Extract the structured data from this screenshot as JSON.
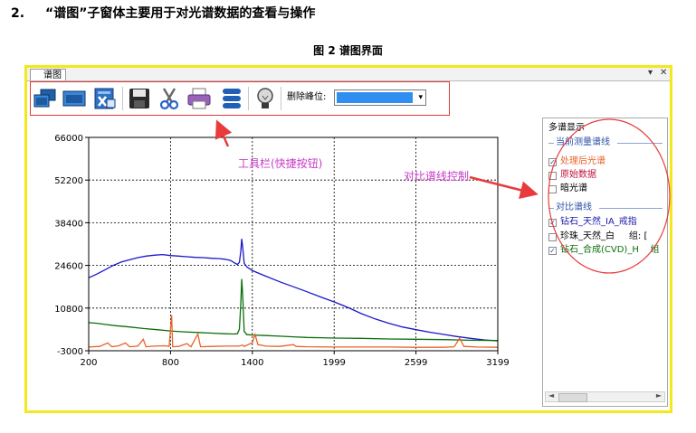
{
  "document": {
    "section_number": "2.",
    "section_heading": "“谱图”子窗体主要用于对光谱数据的查看与操作",
    "figure_caption": "图 2 谱图界面"
  },
  "window": {
    "tab_label": "谱图",
    "pin_glyph": "▾",
    "close_glyph": "✕"
  },
  "toolbar": {
    "buttons": [
      {
        "name": "restore-window-icon"
      },
      {
        "name": "maximize-window-icon"
      },
      {
        "name": "excel-export-icon"
      },
      {
        "name": "save-icon"
      },
      {
        "name": "cut-icon"
      },
      {
        "name": "print-icon"
      },
      {
        "name": "layers-icon"
      },
      {
        "name": "lightbulb-icon"
      }
    ],
    "peak_remove_label": "删除峰位:",
    "peak_remove_color": "#2f8ef0",
    "dropdown_glyph": "▾"
  },
  "panel": {
    "title": "多谱显示",
    "current_group_title": "当前测量谱线",
    "current_items": [
      {
        "label": "处理后光谱",
        "checked": true,
        "color": "#e8632a"
      },
      {
        "label": "原始数据",
        "checked": false,
        "color": "#c0143c"
      },
      {
        "label": "暗光谱",
        "checked": false,
        "color": "#000000"
      }
    ],
    "compare_group_title": "对比谱线",
    "compare_items": [
      {
        "label": "钻石_天然_IA_戒指",
        "checked": true,
        "color": "#1a1aa8"
      },
      {
        "label": "珍珠_天然_白     组: [",
        "checked": false,
        "color": "#000000"
      },
      {
        "label": "钻石_合成(CVD)_H    组",
        "checked": true,
        "color": "#0a6e0a"
      }
    ],
    "check_glyph": "✓",
    "scroll_left": "◄",
    "scroll_right": "►",
    "scroll_thumb": "|||"
  },
  "annotations": {
    "toolbar_note": "工具栏(快捷按钮)",
    "compare_note": "对比谱线控制",
    "arrow_color": "#e83c3c",
    "text_color": "#c83bc8"
  },
  "chart_data": {
    "type": "line",
    "xlim": [
      200,
      3199
    ],
    "ylim": [
      -3000,
      66000
    ],
    "x_ticks": [
      "200",
      "800",
      "1400",
      "1999",
      "2599",
      "3199"
    ],
    "y_ticks": [
      "66000",
      "52200",
      "38400",
      "24600",
      "10800",
      "-3000"
    ],
    "grid": true,
    "series": [
      {
        "color": "#1818c8",
        "points": [
          [
            200,
            20600
          ],
          [
            260,
            21800
          ],
          [
            320,
            23200
          ],
          [
            380,
            24600
          ],
          [
            440,
            25700
          ],
          [
            500,
            26400
          ],
          [
            560,
            27100
          ],
          [
            620,
            27600
          ],
          [
            680,
            27900
          ],
          [
            740,
            28100
          ],
          [
            800,
            27800
          ],
          [
            860,
            27600
          ],
          [
            920,
            27400
          ],
          [
            980,
            27200
          ],
          [
            1040,
            27100
          ],
          [
            1100,
            26900
          ],
          [
            1160,
            26800
          ],
          [
            1200,
            26600
          ],
          [
            1240,
            26200
          ],
          [
            1270,
            25400
          ],
          [
            1290,
            24900
          ],
          [
            1305,
            25600
          ],
          [
            1315,
            29000
          ],
          [
            1322,
            33200
          ],
          [
            1330,
            30000
          ],
          [
            1340,
            25300
          ],
          [
            1360,
            24100
          ],
          [
            1400,
            22900
          ],
          [
            1500,
            21100
          ],
          [
            1600,
            19300
          ],
          [
            1700,
            17700
          ],
          [
            1800,
            16100
          ],
          [
            1900,
            14400
          ],
          [
            2000,
            12800
          ],
          [
            2100,
            11000
          ],
          [
            2200,
            9000
          ],
          [
            2300,
            7300
          ],
          [
            2400,
            5900
          ],
          [
            2500,
            4700
          ],
          [
            2600,
            3800
          ],
          [
            2700,
            3000
          ],
          [
            2800,
            2300
          ],
          [
            2900,
            1600
          ],
          [
            3000,
            1000
          ],
          [
            3100,
            500
          ],
          [
            3199,
            200
          ]
        ]
      },
      {
        "color": "#0a6e0a",
        "points": [
          [
            200,
            6100
          ],
          [
            260,
            5900
          ],
          [
            320,
            5500
          ],
          [
            400,
            5100
          ],
          [
            500,
            4700
          ],
          [
            600,
            4200
          ],
          [
            700,
            3800
          ],
          [
            800,
            3400
          ],
          [
            900,
            3100
          ],
          [
            1000,
            2900
          ],
          [
            1100,
            2700
          ],
          [
            1200,
            2500
          ],
          [
            1260,
            2400
          ],
          [
            1290,
            2500
          ],
          [
            1305,
            4000
          ],
          [
            1315,
            12000
          ],
          [
            1322,
            20200
          ],
          [
            1330,
            14000
          ],
          [
            1340,
            3300
          ],
          [
            1360,
            2200
          ],
          [
            1400,
            2100
          ],
          [
            1500,
            1900
          ],
          [
            1600,
            1700
          ],
          [
            1700,
            1500
          ],
          [
            1800,
            1300
          ],
          [
            1900,
            1200
          ],
          [
            2000,
            1100
          ],
          [
            2200,
            1000
          ],
          [
            2400,
            800
          ],
          [
            2600,
            700
          ],
          [
            2800,
            600
          ],
          [
            3000,
            400
          ],
          [
            3199,
            300
          ]
        ]
      },
      {
        "color": "#e8632a",
        "points": [
          [
            200,
            -1800
          ],
          [
            280,
            -1600
          ],
          [
            340,
            -500
          ],
          [
            370,
            -1700
          ],
          [
            420,
            -1400
          ],
          [
            470,
            -500
          ],
          [
            500,
            -1700
          ],
          [
            560,
            -1500
          ],
          [
            600,
            700
          ],
          [
            620,
            -1700
          ],
          [
            680,
            -1500
          ],
          [
            760,
            -1400
          ],
          [
            790,
            -1600
          ],
          [
            808,
            8500
          ],
          [
            816,
            -1700
          ],
          [
            860,
            -1600
          ],
          [
            920,
            -700
          ],
          [
            950,
            -1700
          ],
          [
            1000,
            2400
          ],
          [
            1020,
            -1700
          ],
          [
            1100,
            -1600
          ],
          [
            1200,
            -1500
          ],
          [
            1300,
            -1500
          ],
          [
            1330,
            -1200
          ],
          [
            1340,
            -1600
          ],
          [
            1400,
            -400
          ],
          [
            1420,
            2300
          ],
          [
            1440,
            -1000
          ],
          [
            1500,
            -1500
          ],
          [
            1600,
            -1600
          ],
          [
            1700,
            -1000
          ],
          [
            1720,
            -1600
          ],
          [
            1800,
            -1700
          ],
          [
            2000,
            -1800
          ],
          [
            2200,
            -1800
          ],
          [
            2400,
            -1800
          ],
          [
            2600,
            -1900
          ],
          [
            2800,
            -1900
          ],
          [
            2880,
            -1700
          ],
          [
            2920,
            1100
          ],
          [
            2950,
            -1600
          ],
          [
            3050,
            -1800
          ],
          [
            3199,
            -1900
          ]
        ]
      }
    ]
  }
}
